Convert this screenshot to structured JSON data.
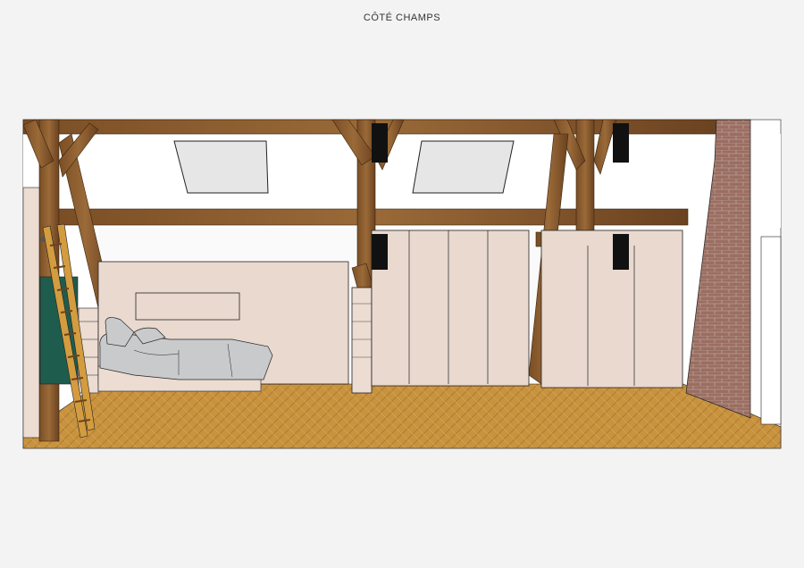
{
  "page": {
    "title": "CÔTÉ CHAMPS"
  },
  "colors": {
    "background": "#f3f3f3",
    "wall": "#ffffff",
    "beam": "#8b5a2b",
    "beam_dark": "#6b4220",
    "cabinet": "#e9d9cf",
    "floor": "#c8933f",
    "brick": "#9b6e62",
    "bedding": "#c9cacc",
    "green_panel": "#1e5c4e",
    "ladder": "#d39c3f",
    "speaker": "#111111",
    "skylight": "#e6e6e6"
  },
  "icons": [
    "ladder-icon",
    "bed-icon",
    "speaker-icon",
    "skylight-icon"
  ]
}
